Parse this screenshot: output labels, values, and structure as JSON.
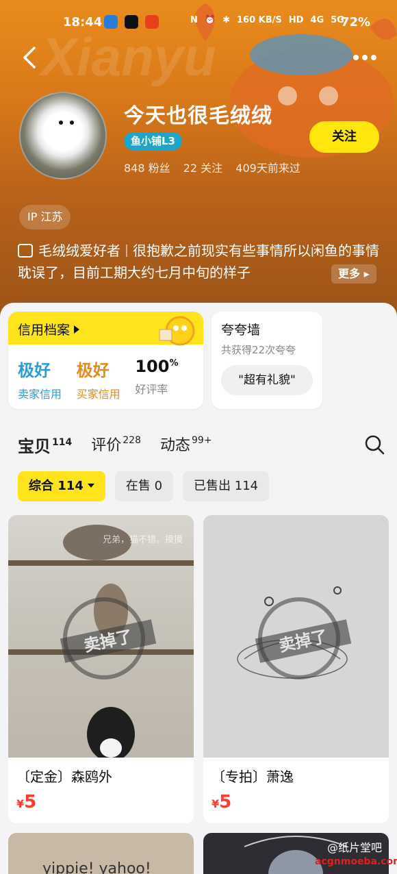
{
  "status_bar": {
    "time": "18:44",
    "network": "160 KB/S",
    "signal": "4G",
    "signal2": "5G",
    "battery": "72%"
  },
  "profile": {
    "username": "今天也很毛绒绒",
    "level_badge": "鱼小铺L3",
    "fans": "848 粉丝",
    "following": "22 关注",
    "last_seen": "409天前来过",
    "follow_label": "关注",
    "ip": "IP 江苏",
    "bio_tag": "毛绒绒爱好者",
    "bio_text": "很抱歉之前现实有些事情所以闲鱼的事情耽误了，目前工期大约七月中旬的样子",
    "more_label": "更多"
  },
  "credit": {
    "title": "信用档案",
    "seller_value": "极好",
    "seller_label": "卖家信用",
    "buyer_value": "极好",
    "buyer_label": "买家信用",
    "rating_value": "100",
    "rating_unit": "%",
    "rating_label": "好评率"
  },
  "praise": {
    "title": "夸夸墙",
    "subtitle": "共获得22次夸夸",
    "chip": "\"超有礼貌\""
  },
  "tabs": [
    {
      "label": "宝贝",
      "count": "114"
    },
    {
      "label": "评价",
      "count": "228"
    },
    {
      "label": "动态",
      "count": "99+"
    }
  ],
  "filters": [
    {
      "label": "综合 114"
    },
    {
      "label": "在售 0"
    },
    {
      "label": "已售出 114"
    }
  ],
  "items": [
    {
      "title": "〔定金〕森鸥外",
      "price": "5",
      "currency": "¥",
      "stamp": "卖掉了",
      "watermark": "兄弟，猫不错。摸摸"
    },
    {
      "title": "〔专拍〕萧逸",
      "price": "5",
      "currency": "¥",
      "stamp": "卖掉了"
    }
  ],
  "bottom_items": [
    {
      "text": "yippie! yahoo!"
    },
    {
      "text": ""
    }
  ],
  "watermark": "@纸片堂吧",
  "watermark_site": "acgnmoeba.com"
}
